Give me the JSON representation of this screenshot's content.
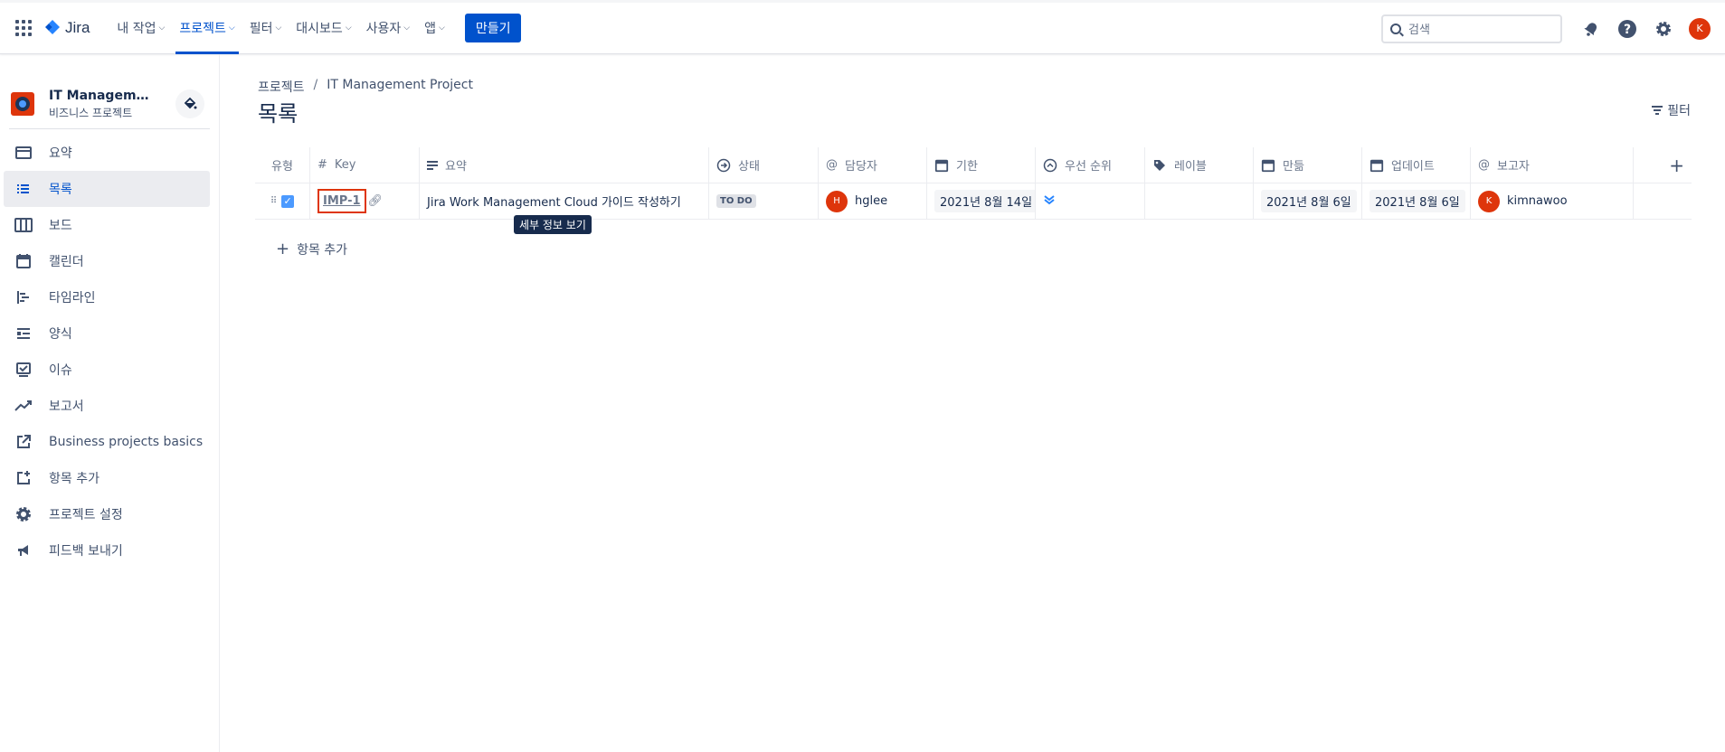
{
  "topnav": {
    "logo": "Jira",
    "items": [
      {
        "label": "내 작업"
      },
      {
        "label": "프로젝트"
      },
      {
        "label": "필터"
      },
      {
        "label": "대시보드"
      },
      {
        "label": "사용자"
      },
      {
        "label": "앱"
      }
    ],
    "create_label": "만들기",
    "search_placeholder": "검색",
    "avatar_initial": "K"
  },
  "sidebar": {
    "project_name": "IT Management...",
    "project_type": "비즈니스 프로젝트",
    "items": [
      {
        "label": "요약",
        "icon": "summary-icon"
      },
      {
        "label": "목록",
        "icon": "list-icon"
      },
      {
        "label": "보드",
        "icon": "board-icon"
      },
      {
        "label": "캘린더",
        "icon": "calendar-icon"
      },
      {
        "label": "타임라인",
        "icon": "timeline-icon"
      },
      {
        "label": "양식",
        "icon": "form-icon"
      },
      {
        "label": "이슈",
        "icon": "issues-icon"
      },
      {
        "label": "보고서",
        "icon": "reports-icon"
      },
      {
        "label": "Business projects basics",
        "icon": "external-link-icon"
      },
      {
        "label": "항목 추가",
        "icon": "add-item-icon"
      },
      {
        "label": "프로젝트 설정",
        "icon": "gear-icon"
      },
      {
        "label": "피드백 보내기",
        "icon": "megaphone-icon"
      }
    ]
  },
  "main": {
    "breadcrumb": {
      "root": "프로젝트",
      "sep": "/",
      "project": "IT Management Project"
    },
    "title": "목록",
    "filter_label": "필터",
    "columns": {
      "type": "유형",
      "key": "Key",
      "summary": "요약",
      "status": "상태",
      "assignee": "담당자",
      "due": "기한",
      "priority": "우선 순위",
      "labels": "레이블",
      "created": "만듦",
      "updated": "업데이트",
      "reporter": "보고자"
    },
    "row": {
      "key": "IMP-1",
      "summary": "Jira Work Management Cloud 가이드 작성하기",
      "status": "TO DO",
      "assignee_initial": "H",
      "assignee": "hglee",
      "due": "2021년 8월 14일",
      "created": "2021년 8월 6일",
      "updated": "2021년 8월 6일",
      "reporter_initial": "K",
      "reporter": "kimnawoo"
    },
    "tooltip": "세부 정보 보기",
    "add_item_label": "항목 추가"
  },
  "colors": {
    "accent": "#0052cc",
    "avatar": "#de350b"
  }
}
